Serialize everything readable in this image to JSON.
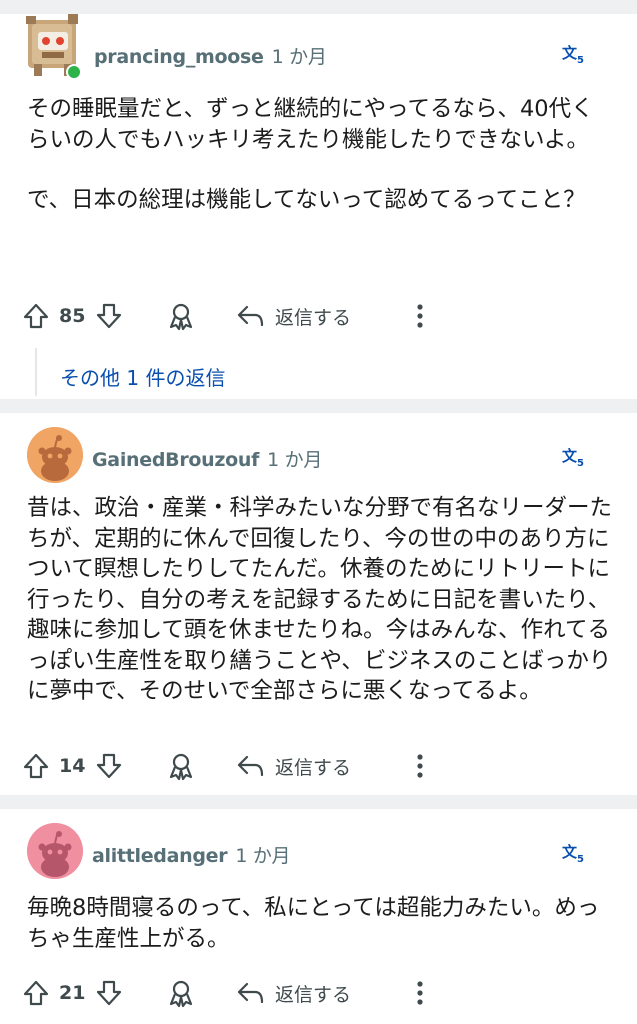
{
  "comments": [
    {
      "username": "prancing_moose",
      "time": "1 か月",
      "body": [
        "その睡眠量だと、ずっと継続的にやってるなら、40代くらいの人でもハッキリ考えたり機能したりできないよ。",
        "で、日本の総理は機能してないって認めてるってこと？"
      ],
      "votes": "85",
      "reply_label": "返信する",
      "more_replies": "その他 1 件の返信",
      "online": true
    },
    {
      "username": "GainedBrouzouf",
      "time": "1 か月",
      "body": [
        "昔は、政治・産業・科学みたいな分野で有名なリーダーたちが、定期的に休んで回復したり、今の世の中のあり方について瞑想したりしてたんだ。休養のためにリトリートに行ったり、自分の考えを記録するために日記を書いたり、趣味に参加して頭を休ませたりね。今はみんな、作れてるっぽい生産性を取り繕うことや、ビジネスのことばっかりに夢中で、そのせいで全部さらに悪くなってるよ。"
      ],
      "votes": "14",
      "reply_label": "返信する",
      "avatar_color": "#f0a565"
    },
    {
      "username": "alittledanger",
      "time": "1 か月",
      "body": [
        "毎晩8時間寝るのって、私にとっては超能力みたい。めっちゃ生産性上がる。"
      ],
      "votes": "21",
      "reply_label": "返信する",
      "avatar_color": "#f08fa0"
    }
  ],
  "icons": {
    "upvote": "arrow-up-outline",
    "downvote": "arrow-down-outline",
    "award": "award-ribbon",
    "reply": "reply-arrow",
    "more": "vertical-dots",
    "translate": "translate"
  },
  "colors": {
    "accent_link": "#0a4fb0",
    "username": "#576f76",
    "online": "#2bb34a",
    "translate_icon": "#0a4fb0"
  }
}
